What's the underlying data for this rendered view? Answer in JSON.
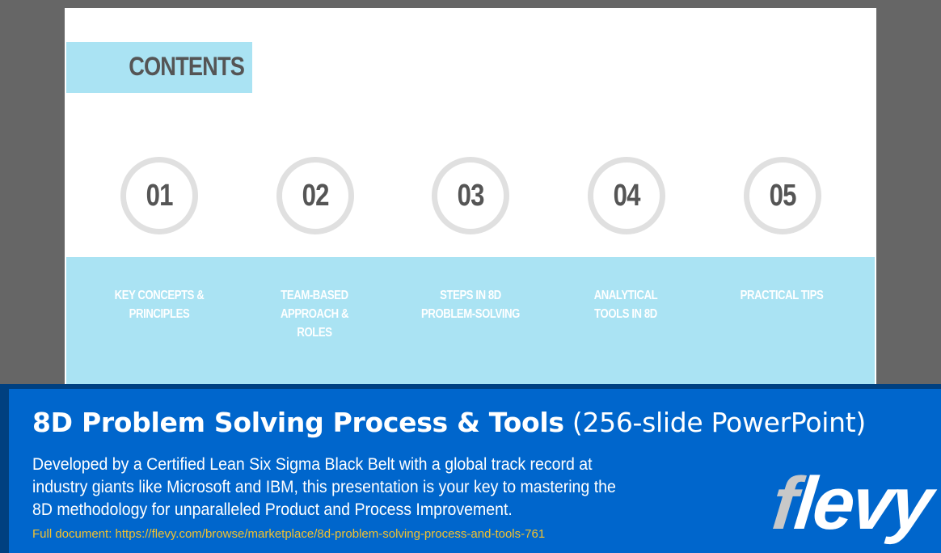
{
  "slide": {
    "contents_title": "CONTENTS",
    "sections": [
      {
        "number": "01",
        "label": "KEY CONCEPTS & PRINCIPLES"
      },
      {
        "number": "02",
        "label": "TEAM-BASED APPROACH & ROLES"
      },
      {
        "number": "03",
        "label": "STEPS IN 8D PROBLEM-SOLVING"
      },
      {
        "number": "04",
        "label": "ANALYTICAL TOOLS IN 8D"
      },
      {
        "number": "05",
        "label": "PRACTICAL TIPS"
      }
    ]
  },
  "banner": {
    "title_bold": "8D Problem Solving Process & Tools",
    "title_light": "(256-slide PowerPoint)",
    "description": "Developed by a Certified Lean Six Sigma Black Belt with a global track record at industry giants like Microsoft and IBM, this presentation is your key to mastering the 8D methodology for unparalleled Product and Process Improvement.",
    "link_text": "Full document: https://flevy.com/browse/marketplace/8d-problem-solving-process-and-tools-761",
    "logo_first": "f",
    "logo_rest": "levy"
  },
  "colors": {
    "background": "#666666",
    "band": "#aae3f3",
    "circle_border": "#e0e0e0",
    "number_text": "#555555",
    "banner_blue": "#0066cc",
    "banner_dark": "#004080",
    "link_yellow": "#f2c12e"
  }
}
